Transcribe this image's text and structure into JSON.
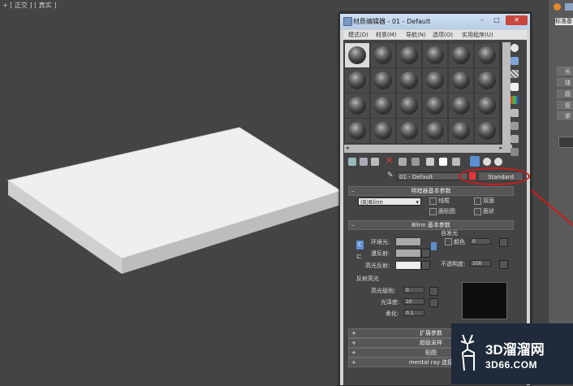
{
  "viewport": {
    "label": "+ [ 正交 ] [ 真实 ]"
  },
  "command_panel": {
    "items": [
      "标准基",
      "长",
      "球",
      "圆",
      "管",
      "圆",
      "茶"
    ]
  },
  "material_editor": {
    "title": "材质编辑器 - 01 - Default",
    "window_buttons": [
      "–",
      "□",
      "✕"
    ],
    "menu": [
      "模式(D)",
      "材质(M)",
      "导航(N)",
      "选项(O)",
      "实用程序(U)"
    ],
    "material_name": "01 - Default",
    "material_type": "Standard",
    "shader_rollout": {
      "title": "明暗器基本参数",
      "shader": "(B)Blinn",
      "options": [
        "线框",
        "双面",
        "面贴图",
        "面状"
      ]
    },
    "blinn_rollout": {
      "title": "Blinn 基本参数",
      "self_illum_title": "自发光",
      "color_label": "颜色",
      "self_illum_value": "0",
      "ambient_label": "环境光:",
      "diffuse_label": "漫反射:",
      "specular_label": "高光反射:",
      "opacity_label": "不透明度:",
      "opacity_value": "100",
      "lock_c": "C"
    },
    "highlights": {
      "title": "反射高光",
      "level_label": "高光级别:",
      "level_value": "0",
      "gloss_label": "光泽度:",
      "gloss_value": "10",
      "soften_label": "柔化:",
      "soften_value": "0.1"
    },
    "rollouts": [
      "扩展参数",
      "超级采样",
      "贴图",
      "mental ray 连接"
    ]
  },
  "watermark": {
    "text": "3D溜溜网",
    "url": "3D66.COM"
  },
  "colors": {
    "viewport_bg": "#444444",
    "box_top": "#efefef",
    "box_side": "#c8c8c8",
    "accent_red": "#d01a1a",
    "logo_bg": "#1f2a3a"
  }
}
